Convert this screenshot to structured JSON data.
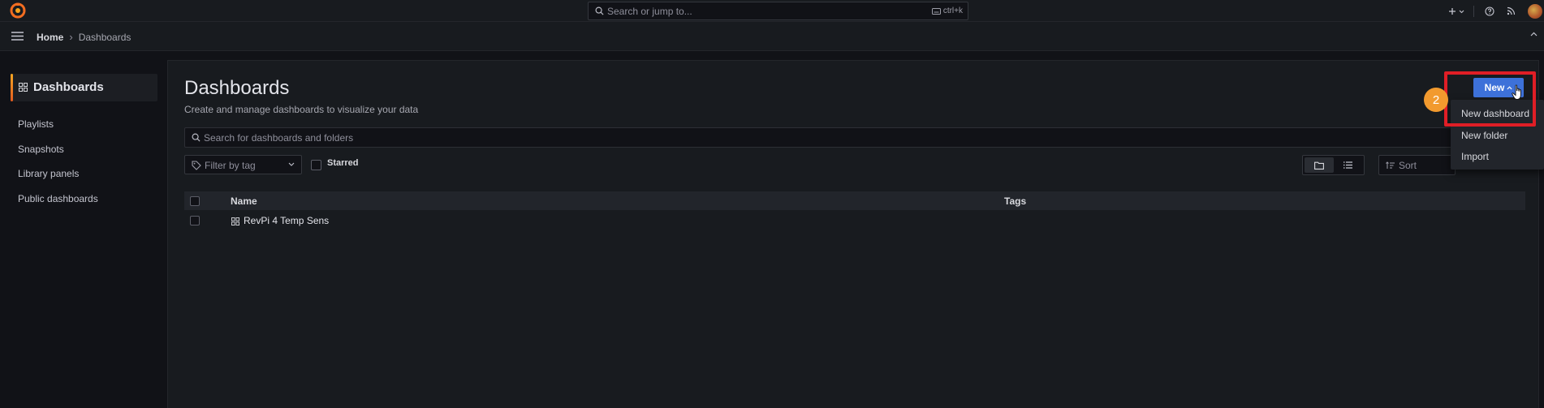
{
  "topbar": {
    "search_placeholder": "Search or jump to...",
    "search_shortcut": "ctrl+k"
  },
  "breadcrumb": {
    "home": "Home",
    "separator": "›",
    "current": "Dashboards"
  },
  "sidebar": {
    "active_label": "Dashboards",
    "items": [
      {
        "label": "Playlists"
      },
      {
        "label": "Snapshots"
      },
      {
        "label": "Library panels"
      },
      {
        "label": "Public dashboards"
      }
    ]
  },
  "main": {
    "title": "Dashboards",
    "subtitle": "Create and manage dashboards to visualize your data",
    "search_placeholder": "Search for dashboards and folders",
    "filter_placeholder": "Filter by tag",
    "starred_label": "Starred",
    "sort_placeholder": "Sort",
    "new_button": "New",
    "table": {
      "headers": {
        "name": "Name",
        "tags": "Tags"
      },
      "rows": [
        {
          "name": "RevPi 4 Temp Sens",
          "tags": ""
        }
      ]
    }
  },
  "new_menu": {
    "items": [
      {
        "label": "New dashboard"
      },
      {
        "label": "New folder"
      },
      {
        "label": "Import"
      }
    ]
  },
  "annotation": {
    "step_number": "2"
  },
  "colors": {
    "accent_blue": "#3d71d9",
    "highlight_red": "#e01e26",
    "badge_orange": "#f29a2e",
    "brand_orange": "#f5a623"
  }
}
